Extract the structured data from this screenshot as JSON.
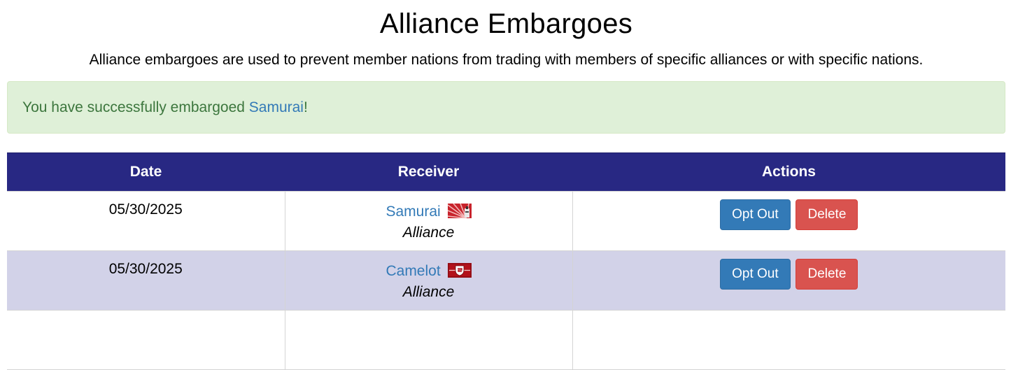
{
  "page": {
    "title": "Alliance Embargoes",
    "subtitle": "Alliance embargoes are used to prevent member nations from trading with members of specific alliances or with specific nations."
  },
  "alert": {
    "prefix": "You have successfully embargoed ",
    "link_text": "Samurai",
    "suffix": "!"
  },
  "table": {
    "headers": [
      "Date",
      "Receiver",
      "Actions"
    ],
    "rows": [
      {
        "date": "05/30/2025",
        "receiver": "Samurai",
        "receiver_type": "Alliance",
        "flag_icon": "samurai-flag-icon",
        "opt_out_label": "Opt Out",
        "delete_label": "Delete"
      },
      {
        "date": "05/30/2025",
        "receiver": "Camelot",
        "receiver_type": "Alliance",
        "flag_icon": "camelot-flag-icon",
        "opt_out_label": "Opt Out",
        "delete_label": "Delete"
      }
    ]
  },
  "colors": {
    "header_bg": "#282883",
    "alert_bg": "#dff0d8",
    "alert_text": "#3c763d",
    "link": "#337ab7",
    "btn_primary": "#337ab7",
    "btn_danger": "#d9534f",
    "alt_row": "#d2d2e8"
  }
}
